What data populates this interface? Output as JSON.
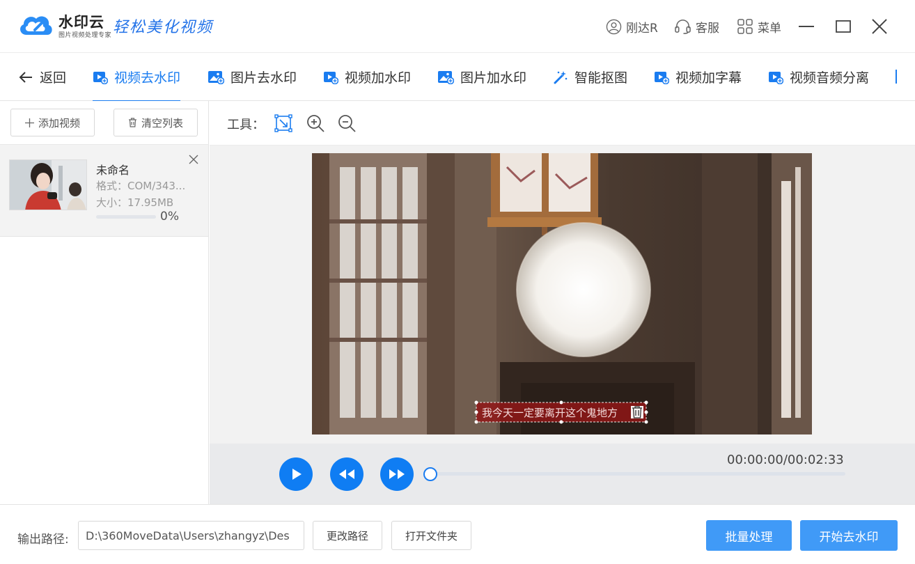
{
  "app": {
    "brand": "水印云",
    "brand_sub": "图片视频处理专家",
    "slogan": "轻松美化视频"
  },
  "titlebar": {
    "user": "刚达R",
    "service": "客服",
    "menu": "菜单"
  },
  "tabs": [
    {
      "label": "返回",
      "icon": "back-arrow-icon"
    },
    {
      "label": "视频去水印",
      "icon": "video-icon",
      "active": true
    },
    {
      "label": "图片去水印",
      "icon": "image-icon"
    },
    {
      "label": "视频加水印",
      "icon": "video-icon"
    },
    {
      "label": "图片加水印",
      "icon": "image-icon"
    },
    {
      "label": "智能抠图",
      "icon": "magic-wand-icon"
    },
    {
      "label": "视频加字幕",
      "icon": "video-icon"
    },
    {
      "label": "视频音频分离",
      "icon": "video-icon"
    }
  ],
  "left": {
    "add_video": "添加视频",
    "clear_list": "清空列表",
    "files": [
      {
        "name": "未命名",
        "format": "格式：COM/343...",
        "size": "大小：17.95MB",
        "progress_pct": 0,
        "progress_text": "0%"
      }
    ]
  },
  "toolbar": {
    "label": "工具："
  },
  "video": {
    "subtitle": "我今天一定要离开这个鬼地方"
  },
  "player": {
    "time": "00:00:00/00:02:33",
    "progress": 0
  },
  "bottom": {
    "output_label": "输出路径:",
    "output_path": "D:\\360MoveData\\Users\\zhangyz\\Des",
    "change_path": "更改路径",
    "open_folder": "打开文件夹",
    "batch": "批量处理",
    "start": "开始去水印"
  },
  "colors": {
    "accent": "#1a7cf0",
    "primary_button": "#409af7",
    "play_button": "#0f7df3"
  }
}
